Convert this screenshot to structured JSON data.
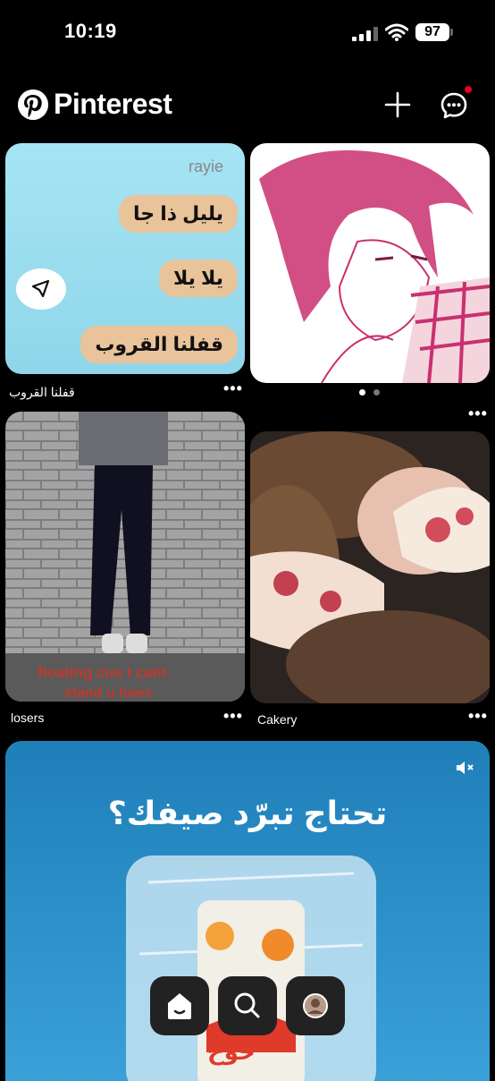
{
  "status_bar": {
    "time": "10:19",
    "battery": "97"
  },
  "header": {
    "app_name": "Pinterest"
  },
  "pins": [
    {
      "username_label": "rayie",
      "bubbles": [
        "يليل ذا جا",
        "يلا يلا",
        "قفلنا القروب"
      ],
      "caption": "قفلنا القروب"
    },
    {
      "caption": ""
    },
    {
      "overlay_text_1": "floating cus I cant",
      "overlay_text_2": "stand u hoes",
      "caption": "losers"
    },
    {
      "caption": "Cakery"
    },
    {
      "headline": "تحتاج تبرّد صيفك؟",
      "can_text": "خوخ"
    }
  ],
  "more_label": "•••",
  "colors": {
    "accent": "#e60023",
    "background": "#000000",
    "ad_blue": "#1f7fb8"
  },
  "icons": [
    "pinterest-logo-icon",
    "plus-icon",
    "chat-icon",
    "send-icon",
    "mute-icon",
    "home-icon",
    "search-icon",
    "profile-avatar-icon"
  ]
}
